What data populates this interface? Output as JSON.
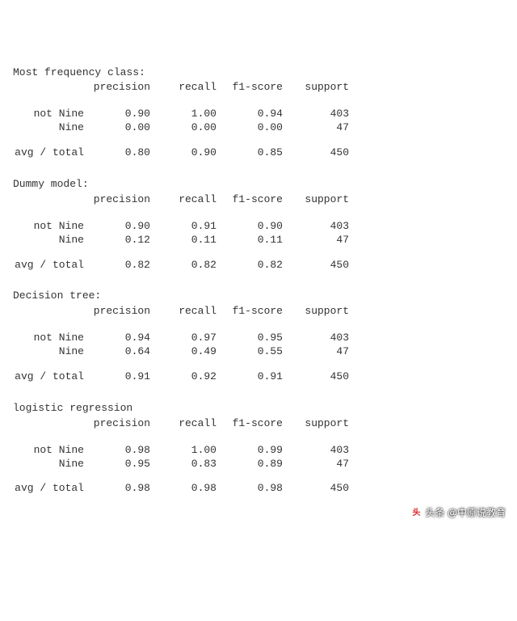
{
  "headers": {
    "precision": "precision",
    "recall": "recall",
    "f1": "f1-score",
    "support": "support",
    "avg_label": "avg / total"
  },
  "reports": [
    {
      "title": "Most frequency class:",
      "rows": [
        {
          "label": "not Nine",
          "precision": "0.90",
          "recall": "1.00",
          "f1": "0.94",
          "support": "403"
        },
        {
          "label": "Nine",
          "precision": "0.00",
          "recall": "0.00",
          "f1": "0.00",
          "support": "47"
        }
      ],
      "total": {
        "precision": "0.80",
        "recall": "0.90",
        "f1": "0.85",
        "support": "450"
      }
    },
    {
      "title": "Dummy model:",
      "rows": [
        {
          "label": "not Nine",
          "precision": "0.90",
          "recall": "0.91",
          "f1": "0.90",
          "support": "403"
        },
        {
          "label": "Nine",
          "precision": "0.12",
          "recall": "0.11",
          "f1": "0.11",
          "support": "47"
        }
      ],
      "total": {
        "precision": "0.82",
        "recall": "0.82",
        "f1": "0.82",
        "support": "450"
      }
    },
    {
      "title": "Decision tree:",
      "rows": [
        {
          "label": "not Nine",
          "precision": "0.94",
          "recall": "0.97",
          "f1": "0.95",
          "support": "403"
        },
        {
          "label": "Nine",
          "precision": "0.64",
          "recall": "0.49",
          "f1": "0.55",
          "support": "47"
        }
      ],
      "total": {
        "precision": "0.91",
        "recall": "0.92",
        "f1": "0.91",
        "support": "450"
      }
    },
    {
      "title": "logistic regression",
      "rows": [
        {
          "label": "not Nine",
          "precision": "0.98",
          "recall": "1.00",
          "f1": "0.99",
          "support": "403"
        },
        {
          "label": "Nine",
          "precision": "0.95",
          "recall": "0.83",
          "f1": "0.89",
          "support": "47"
        }
      ],
      "total": {
        "precision": "0.98",
        "recall": "0.98",
        "f1": "0.98",
        "support": "450"
      }
    }
  ],
  "watermark": {
    "prefix": "头条",
    "handle": "@中原说教育"
  }
}
